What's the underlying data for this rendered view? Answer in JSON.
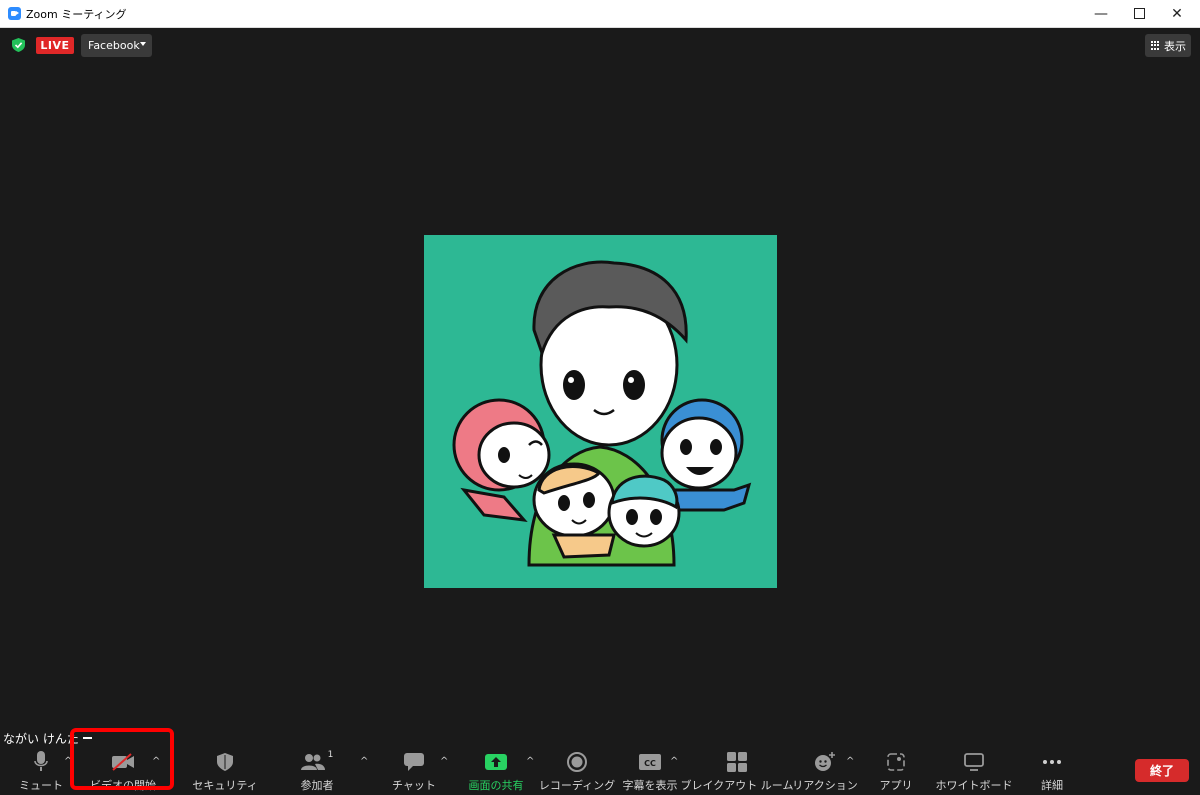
{
  "window": {
    "title": "Zoom ミーティング"
  },
  "status": {
    "live": "LIVE",
    "platform": "Facebook",
    "view": "表示"
  },
  "participant": {
    "name": "ながい けんた"
  },
  "toolbar": {
    "mute": "ミュート",
    "video": "ビデオの開始",
    "security": "セキュリティ",
    "participants": "参加者",
    "participants_count": "1",
    "chat": "チャット",
    "share": "画面の共有",
    "record": "レコーディング",
    "captions": "字幕を表示",
    "breakout": "ブレイクアウト ルーム",
    "reactions": "リアクション",
    "apps": "アプリ",
    "whiteboard": "ホワイトボード",
    "more": "詳細",
    "end": "終了"
  },
  "colors": {
    "live": "#e02828",
    "share_green": "#28d262",
    "avatar_bg": "#2db894",
    "end": "#d62b2b",
    "highlight": "#ff0000"
  }
}
